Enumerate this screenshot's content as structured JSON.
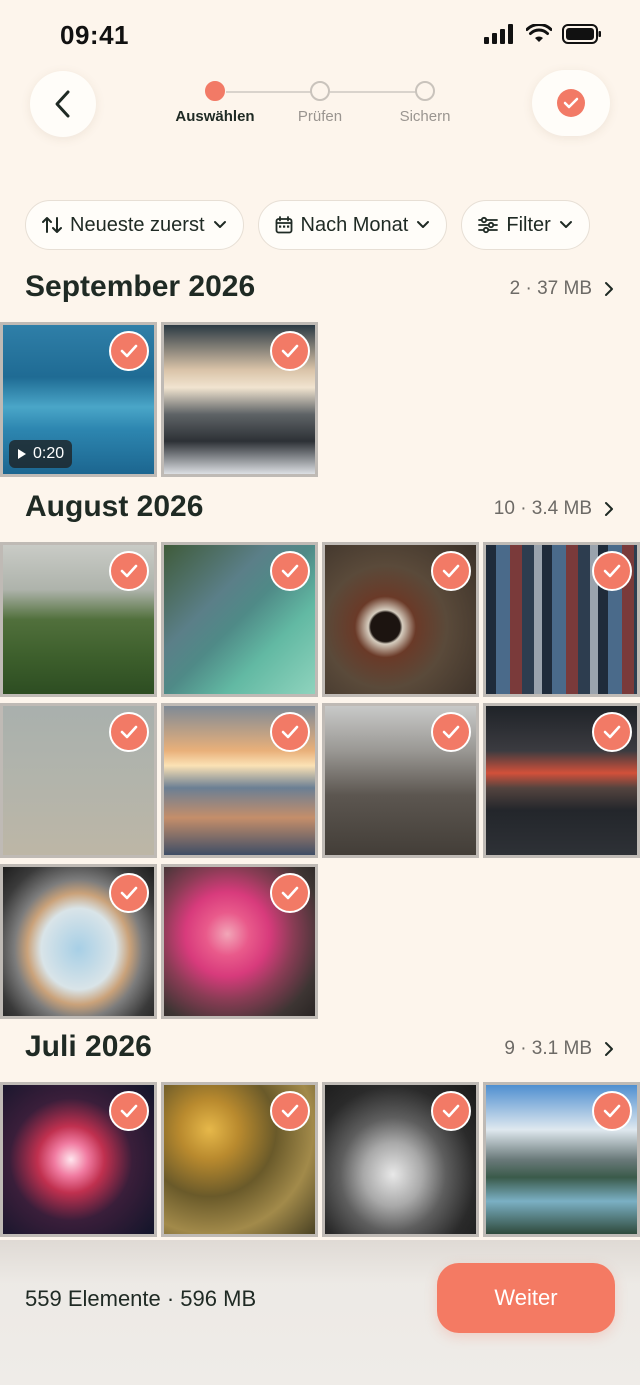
{
  "status_bar": {
    "time": "09:41"
  },
  "stepper": {
    "steps": [
      {
        "label": "Auswählen",
        "active": true
      },
      {
        "label": "Prüfen",
        "active": false
      },
      {
        "label": "Sichern",
        "active": false
      }
    ]
  },
  "filters": {
    "sort_label": "Neueste zuerst",
    "group_label": "Nach Monat",
    "filter_label": "Filter"
  },
  "sections": [
    {
      "title": "September 2026",
      "meta": "2 · 37 MB"
    },
    {
      "title": "August 2026",
      "meta": "10 · 3.4 MB"
    },
    {
      "title": "Juli 2026",
      "meta": "9 · 3.1 MB"
    }
  ],
  "september_items": [
    {
      "subject": "ocean-wave-surfers",
      "selected": true,
      "duration": "0:20"
    },
    {
      "subject": "snowy-mountain-clouds",
      "selected": true
    }
  ],
  "august_items": [
    {
      "subject": "foggy-meadow",
      "selected": true
    },
    {
      "subject": "river-aerial",
      "selected": true
    },
    {
      "subject": "coffee-cup-hands",
      "selected": true
    },
    {
      "subject": "bookshelf",
      "selected": true
    },
    {
      "subject": "birds-in-sky",
      "selected": true
    },
    {
      "subject": "sunset-beach",
      "selected": true
    },
    {
      "subject": "dark-sand-shore",
      "selected": true
    },
    {
      "subject": "red-sky-road",
      "selected": true
    },
    {
      "subject": "airplane-window",
      "selected": true
    },
    {
      "subject": "pink-hair-ice-cream",
      "selected": true
    }
  ],
  "july_items": [
    {
      "subject": "fireworks",
      "selected": true
    },
    {
      "subject": "sunflowers",
      "selected": true
    },
    {
      "subject": "sleeping-kitten",
      "selected": true
    },
    {
      "subject": "mountain-lake",
      "selected": true
    }
  ],
  "footer": {
    "summary": "559 Elemente · 596 MB",
    "next_label": "Weiter"
  },
  "colors": {
    "accent": "#f27a66",
    "background": "#fdf5ec",
    "text": "#1f2a24"
  }
}
